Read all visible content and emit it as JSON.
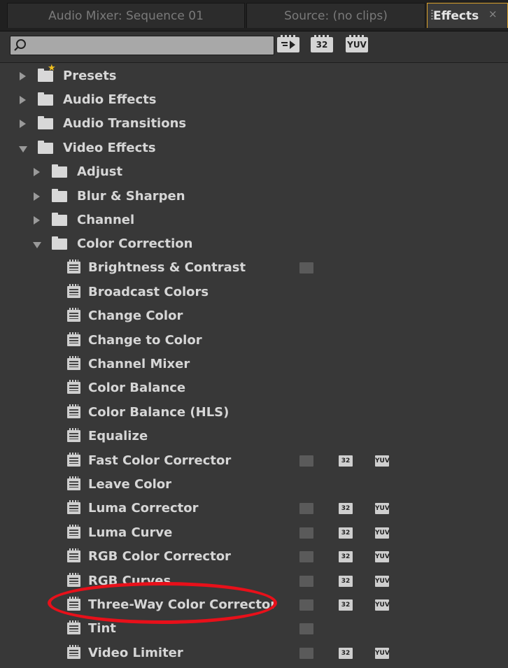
{
  "tabs": [
    {
      "label": "Audio Mixer: Sequence 01"
    },
    {
      "label": "Source: (no clips)"
    },
    {
      "label": "Effects",
      "close": "×"
    }
  ],
  "toolbar": {
    "search_value": "",
    "badges": [
      "",
      "32",
      "YUV"
    ]
  },
  "tree": {
    "presets": "Presets",
    "audio_effects": "Audio Effects",
    "audio_transitions": "Audio Transitions",
    "video_effects": "Video Effects",
    "adjust": "Adjust",
    "blur_sharpen": "Blur & Sharpen",
    "channel": "Channel",
    "color_correction": "Color Correction",
    "effects": [
      "Brightness & Contrast",
      "Broadcast Colors",
      "Change Color",
      "Change to Color",
      "Channel Mixer",
      "Color Balance",
      "Color Balance (HLS)",
      "Equalize",
      "Fast Color Corrector",
      "Leave Color",
      "Luma Corrector",
      "Luma Curve",
      "RGB Color Corrector",
      "RGB Curves",
      "Three-Way Color Corrector",
      "Tint",
      "Video Limiter"
    ],
    "badge_32": "32",
    "badge_yuv": "YUV"
  },
  "colors": {
    "panel_bg": "#383838",
    "active_tab_border": "#d9a02b",
    "highlight_ring": "#e8101a"
  }
}
